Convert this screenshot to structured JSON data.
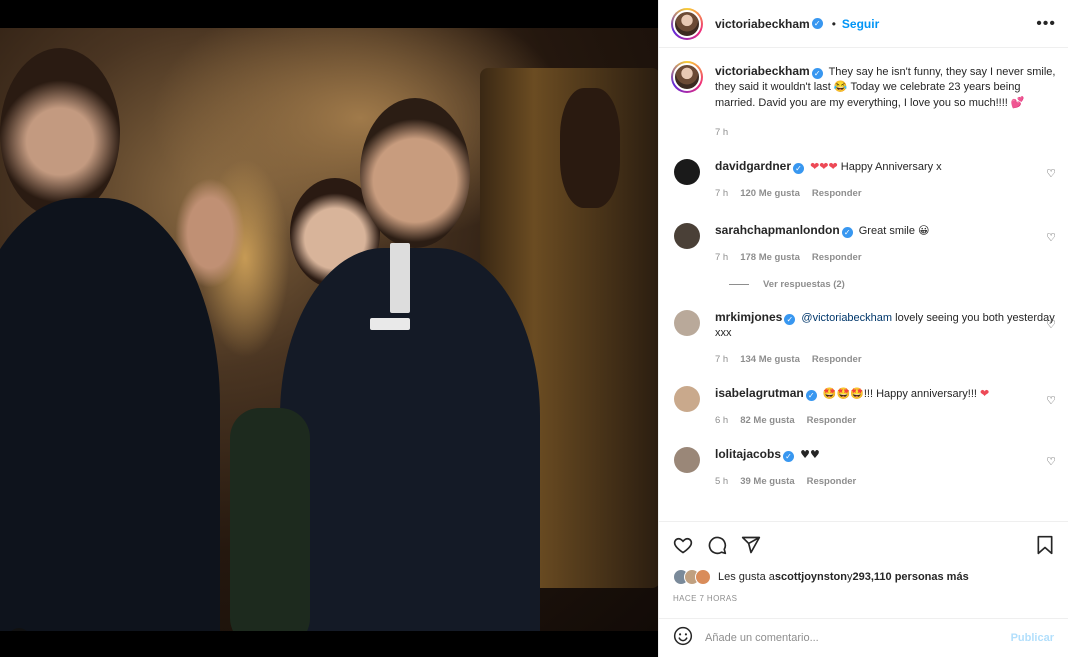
{
  "post": {
    "author": "victoriabeckham",
    "follow_label": "Seguir",
    "dot": "•",
    "more_icon": "•••",
    "caption": "They say he isn't funny, they say I never smile, they said it wouldn't last 😂 Today we celebrate 23 years being married. David you are my everything, I love you so much!!!! ",
    "caption_emoji_end": "💕",
    "caption_time": "7 h"
  },
  "comments": [
    {
      "user": "davidgardner",
      "text_emoji": "❤❤❤",
      "text": " Happy Anniversary x",
      "time": "7 h",
      "likes": "120 Me gusta",
      "reply": "Responder",
      "avatar_color": "#1a1a1a"
    },
    {
      "user": "sarahchapmanlondon",
      "text": "Great smile ",
      "text_emoji": "😀",
      "time": "7 h",
      "likes": "178 Me gusta",
      "reply": "Responder",
      "avatar_color": "#4a4037",
      "view_replies": "Ver respuestas (2)"
    },
    {
      "user": "mrkimjones",
      "mention": "@victoriabeckham",
      "text": " lovely seeing you both yesterday xxx",
      "time": "7 h",
      "likes": "134 Me gusta",
      "reply": "Responder",
      "avatar_color": "#b9a99a"
    },
    {
      "user": "isabelagrutman",
      "text_emoji": "🤩🤩🤩",
      "text": "!!! Happy anniversary!!! ",
      "text_emoji_end": "❤",
      "time": "6 h",
      "likes": "82 Me gusta",
      "reply": "Responder",
      "avatar_color": "#c9a98c"
    },
    {
      "user": "lolitajacobs",
      "text_emoji": "♥♥",
      "time": "5 h",
      "likes": "39 Me gusta",
      "reply": "Responder",
      "avatar_color": "#9a8778"
    }
  ],
  "actions": {
    "liked_by_prefix": "Les gusta a ",
    "liked_by_user": "scottjoynston",
    "liked_by_mid": " y ",
    "liked_by_count": "293,110 personas más",
    "time_ago": "HACE 7 HORAS"
  },
  "composer": {
    "placeholder": "Añade un comentario...",
    "publish_label": "Publicar"
  }
}
